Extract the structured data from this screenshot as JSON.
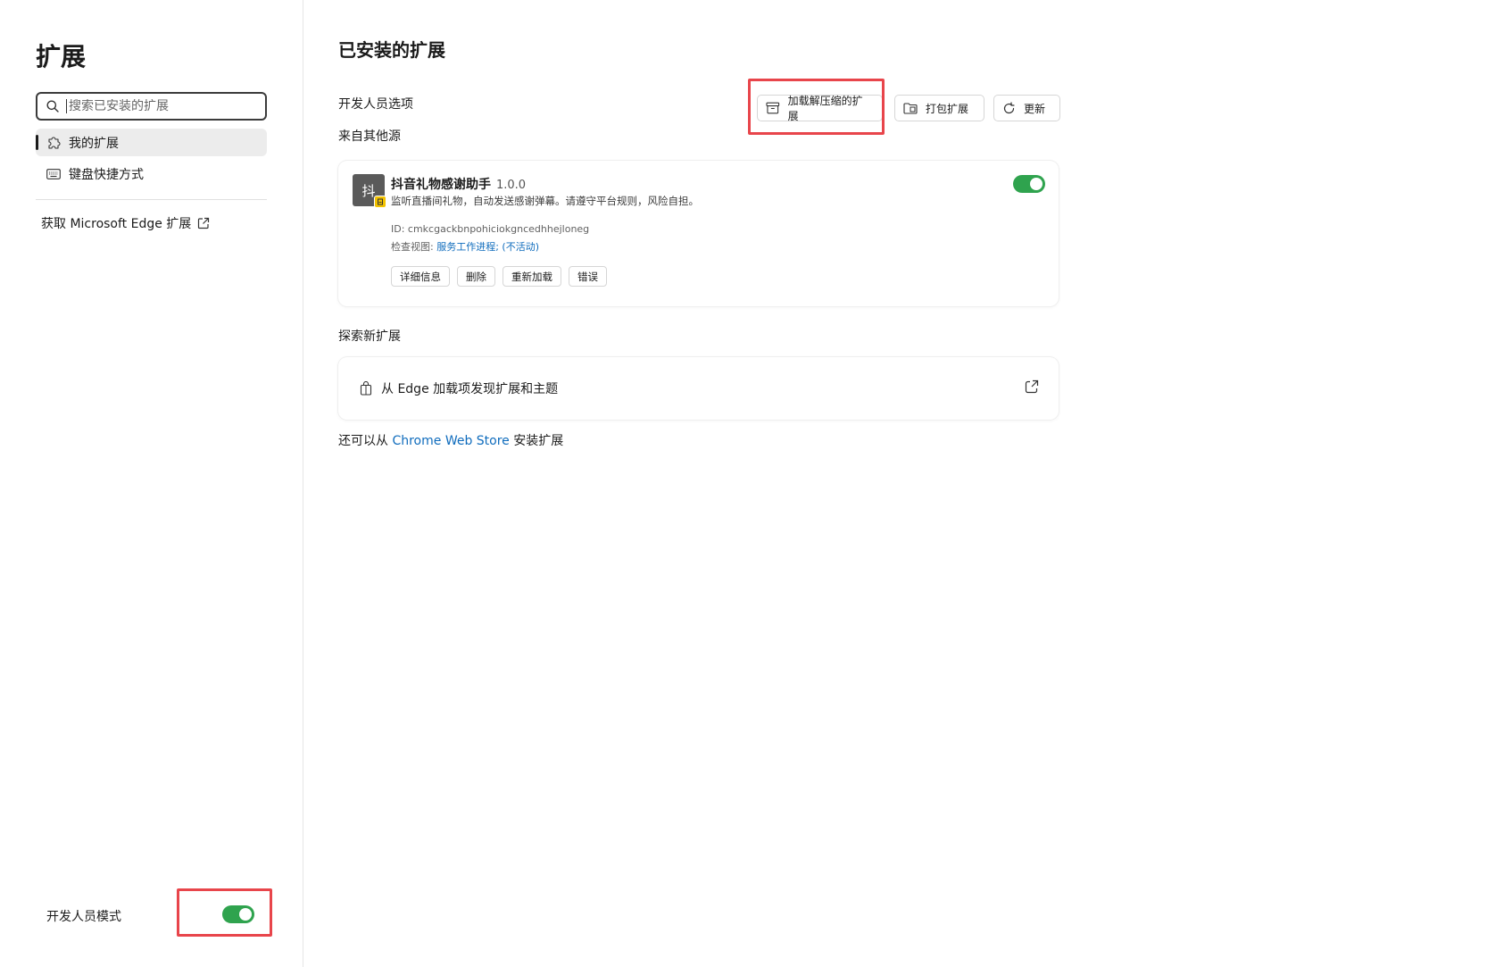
{
  "sidebar": {
    "title": "扩展",
    "search_placeholder": "搜索已安装的扩展",
    "nav": [
      {
        "label": "我的扩展",
        "active": true,
        "icon": "puzzle-icon"
      },
      {
        "label": "键盘快捷方式",
        "active": false,
        "icon": "keyboard-icon"
      }
    ],
    "get_extensions_label": "获取 Microsoft Edge 扩展",
    "developer_mode_label": "开发人员模式",
    "developer_mode_on": true
  },
  "main": {
    "title": "已安装的扩展",
    "developer_options_label": "开发人员选项",
    "toolbar": {
      "load_unpacked": "加载解压缩的扩展",
      "pack": "打包扩展",
      "update": "更新"
    },
    "other_sources_label": "来自其他源",
    "extension": {
      "icon_char": "抖",
      "name": "抖音礼物感谢助手",
      "version": "1.0.0",
      "description": "监听直播间礼物，自动发送感谢弹幕。请遵守平台规则，风险自担。",
      "id_text": "ID: cmkcgackbnpohiciokgncedhhejloneg",
      "inspect_prefix": "检查视图: ",
      "inspect_link": "服务工作进程; (不活动)",
      "enabled": true,
      "actions": [
        "详细信息",
        "删除",
        "重新加载",
        "错误"
      ]
    },
    "discover_label": "探索新扩展",
    "discover_row": "从 Edge 加载项发现扩展和主题",
    "also_install_prefix": "还可以从 ",
    "also_install_link": "Chrome Web Store",
    "also_install_suffix": " 安装扩展"
  },
  "colors": {
    "accent_green": "#2fa34e",
    "link_blue": "#0f6cbd",
    "highlight_red": "#e8454b"
  }
}
